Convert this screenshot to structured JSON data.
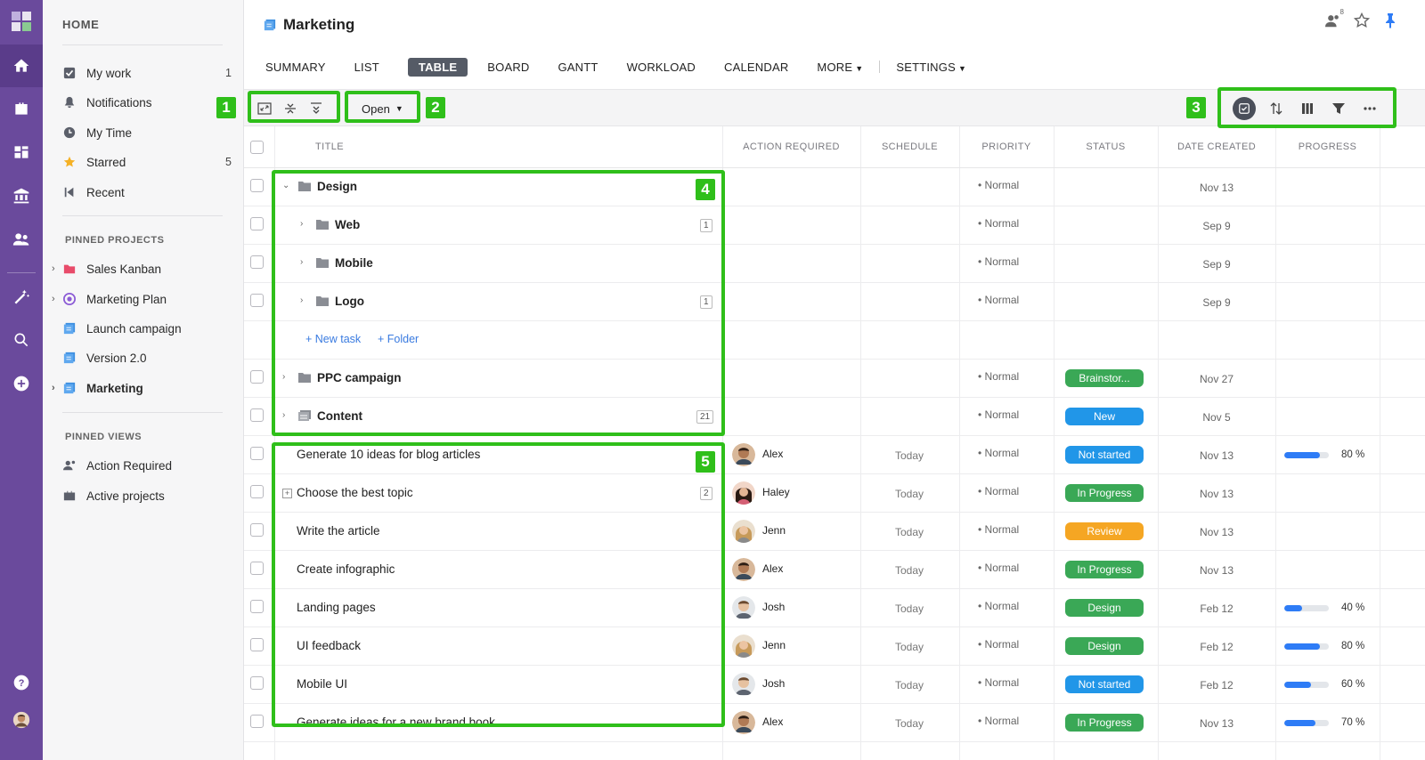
{
  "sidebar": {
    "home": "HOME",
    "items": [
      {
        "label": "My work",
        "count": "1"
      },
      {
        "label": "Notifications",
        "count": ""
      },
      {
        "label": "My Time",
        "count": ""
      },
      {
        "label": "Starred",
        "count": "5"
      },
      {
        "label": "Recent",
        "count": ""
      }
    ],
    "pinned_projects_label": "PINNED PROJECTS",
    "projects": [
      {
        "label": "Sales Kanban"
      },
      {
        "label": "Marketing Plan"
      },
      {
        "label": "Launch campaign"
      },
      {
        "label": "Version 2.0"
      },
      {
        "label": "Marketing"
      }
    ],
    "pinned_views_label": "PINNED VIEWS",
    "views": [
      {
        "label": "Action Required"
      },
      {
        "label": "Active projects"
      }
    ]
  },
  "header": {
    "title": "Marketing",
    "members_count": "8",
    "tabs": [
      "SUMMARY",
      "LIST",
      "TABLE",
      "BOARD",
      "GANTT",
      "WORKLOAD",
      "CALENDAR",
      "MORE",
      "SETTINGS"
    ]
  },
  "toolbar": {
    "open_label": "Open"
  },
  "annotations": [
    "1",
    "2",
    "3",
    "4",
    "5"
  ],
  "columns": [
    "TITLE",
    "ACTION REQUIRED",
    "SCHEDULE",
    "PRIORITY",
    "STATUS",
    "DATE CREATED",
    "PROGRESS"
  ],
  "add_links": {
    "new_task": "+ New task",
    "folder": "+ Folder"
  },
  "rows": [
    {
      "title": "Design",
      "count": "",
      "priority": "Normal",
      "date": "Nov 13"
    },
    {
      "title": "Web",
      "count": "1",
      "priority": "Normal",
      "date": "Sep 9"
    },
    {
      "title": "Mobile",
      "count": "",
      "priority": "Normal",
      "date": "Sep 9"
    },
    {
      "title": "Logo",
      "count": "1",
      "priority": "Normal",
      "date": "Sep 9"
    },
    {
      "title": "PPC campaign",
      "count": "",
      "priority": "Normal",
      "status": "Brainstor...",
      "date": "Nov 27"
    },
    {
      "title": "Content",
      "count": "21",
      "priority": "Normal",
      "status": "New",
      "date": "Nov 5"
    },
    {
      "title": "Generate 10 ideas for blog articles",
      "user": "Alex",
      "schedule": "Today",
      "priority": "Normal",
      "status": "Not started",
      "date": "Nov 13",
      "progress": "80 %"
    },
    {
      "title": "Choose the best topic",
      "count": "2",
      "user": "Haley",
      "schedule": "Today",
      "priority": "Normal",
      "status": "In Progress",
      "date": "Nov 13"
    },
    {
      "title": "Write the article",
      "user": "Jenn",
      "schedule": "Today",
      "priority": "Normal",
      "status": "Review",
      "date": "Nov 13"
    },
    {
      "title": "Create infographic",
      "user": "Alex",
      "schedule": "Today",
      "priority": "Normal",
      "status": "In Progress",
      "date": "Nov 13"
    },
    {
      "title": "Landing pages",
      "user": "Josh",
      "schedule": "Today",
      "priority": "Normal",
      "status": "Design",
      "date": "Feb 12",
      "progress": "40 %"
    },
    {
      "title": "UI feedback",
      "user": "Jenn",
      "schedule": "Today",
      "priority": "Normal",
      "status": "Design",
      "date": "Feb 12",
      "progress": "80 %"
    },
    {
      "title": "Mobile UI",
      "user": "Josh",
      "schedule": "Today",
      "priority": "Normal",
      "status": "Not started",
      "date": "Feb 12",
      "progress": "60 %"
    },
    {
      "title": "Generate ideas for a new brand book",
      "user": "Alex",
      "schedule": "Today",
      "priority": "Normal",
      "status": "In Progress",
      "date": "Nov 13",
      "progress": "70 %"
    }
  ],
  "progress_values": [
    0.8,
    0.4,
    0.8,
    0.6,
    0.7
  ],
  "colors": {
    "rail": "#6a4a9c",
    "annotation": "#2fbf1a",
    "status_brainstorm": "#3aa856",
    "status_new": "#2196e8",
    "status_not_started": "#2196e8",
    "status_in_progress": "#3aa856",
    "status_review": "#f5a623",
    "status_design": "#3aa856",
    "progress": "#2e7cf6"
  }
}
